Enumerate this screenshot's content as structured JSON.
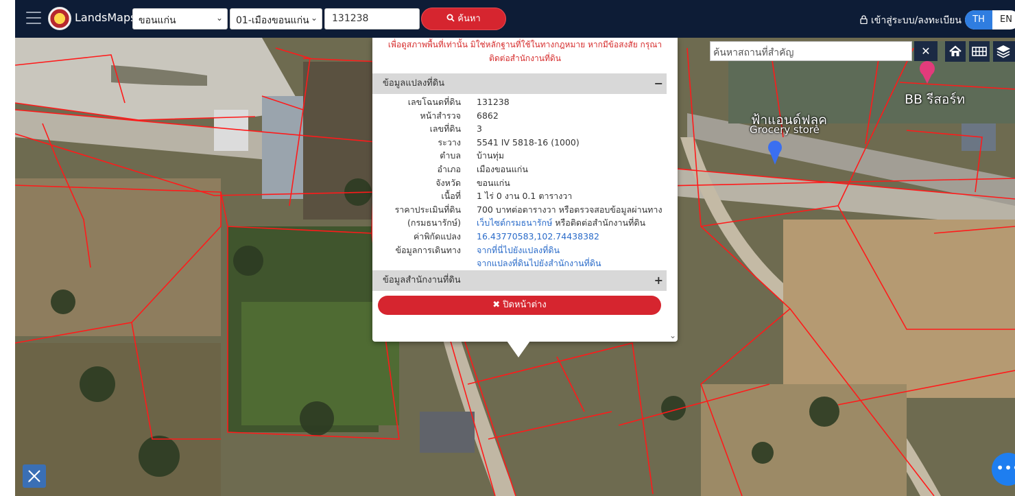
{
  "header": {
    "brand": "LandsMaps",
    "province": "ขอนแก่น",
    "district": "01-เมืองขอนแก่น",
    "parcel_no": "131238",
    "search_label": "ค้นหา",
    "login_label": "เข้าสู่ระบบ/ลงทะเบียน",
    "lang_th": "TH",
    "lang_en": "EN"
  },
  "place_search": {
    "placeholder": "ค้นหาสถานที่สำคัญ",
    "clear": "✕"
  },
  "map_labels": {
    "poi_1": "BB รีสอร์ท",
    "poi_2": "ฟ้าแอนด์ฟลุค",
    "poi_2_sub": "Grocery store"
  },
  "popup": {
    "notice_line1": "เพื่อดูสภาพพื้นที่เท่านั้น มิใช่หลักฐานที่ใช้ในทางกฎหมาย หากมีข้อสงสัย กรุณา",
    "notice_line2": "ติดต่อสำนักงานที่ดิน",
    "section_parcel": "ข้อมูลแปลงที่ดิน",
    "section_parcel_toggle": "−",
    "rows": [
      {
        "k": "เลขโฉนดที่ดิน",
        "v": "131238"
      },
      {
        "k": "หน้าสำรวจ",
        "v": "6862"
      },
      {
        "k": "เลขที่ดิน",
        "v": "3"
      },
      {
        "k": "ระวาง",
        "v": "5541 IV 5818-16 (1000)"
      },
      {
        "k": "ตำบล",
        "v": "บ้านทุ่ม"
      },
      {
        "k": "อำเภอ",
        "v": "เมืองขอนแก่น"
      },
      {
        "k": "จังหวัด",
        "v": "ขอนแก่น"
      },
      {
        "k": "เนื้อที่",
        "v": "1 ไร่ 0 งาน 0.1 ตารางวา"
      },
      {
        "k": "ราคาประเมินที่ดิน",
        "v": "700 บาทต่อตารางวา หรือตรวจสอบข้อมูลผ่านทาง"
      },
      {
        "k": "(กรมธนารักษ์)",
        "v": "เว็บไซต์กรมธนารักษ์",
        "v2": " หรือติดต่อสำนักงานที่ดิน"
      },
      {
        "k": "ค่าพิกัดแปลง",
        "v": "16.43770583,102.74438382"
      },
      {
        "k": "ข้อมูลการเดินทาง",
        "v": "จากที่นี่ไปยังแปลงที่ดิน"
      },
      {
        "k": "",
        "v": "จากแปลงที่ดินไปยังสำนักงานที่ดิน"
      }
    ],
    "section_office": "ข้อมูลสำนักงานที่ดิน",
    "section_office_toggle": "+",
    "close_label": "✖ ปิดหน้าต่าง"
  },
  "colors": {
    "topbar": "#0d1c36",
    "accent_red": "#d6252f",
    "lang_active": "#2f7de0",
    "parcel_line": "#ff1a1a",
    "link": "#2a6bc9"
  }
}
